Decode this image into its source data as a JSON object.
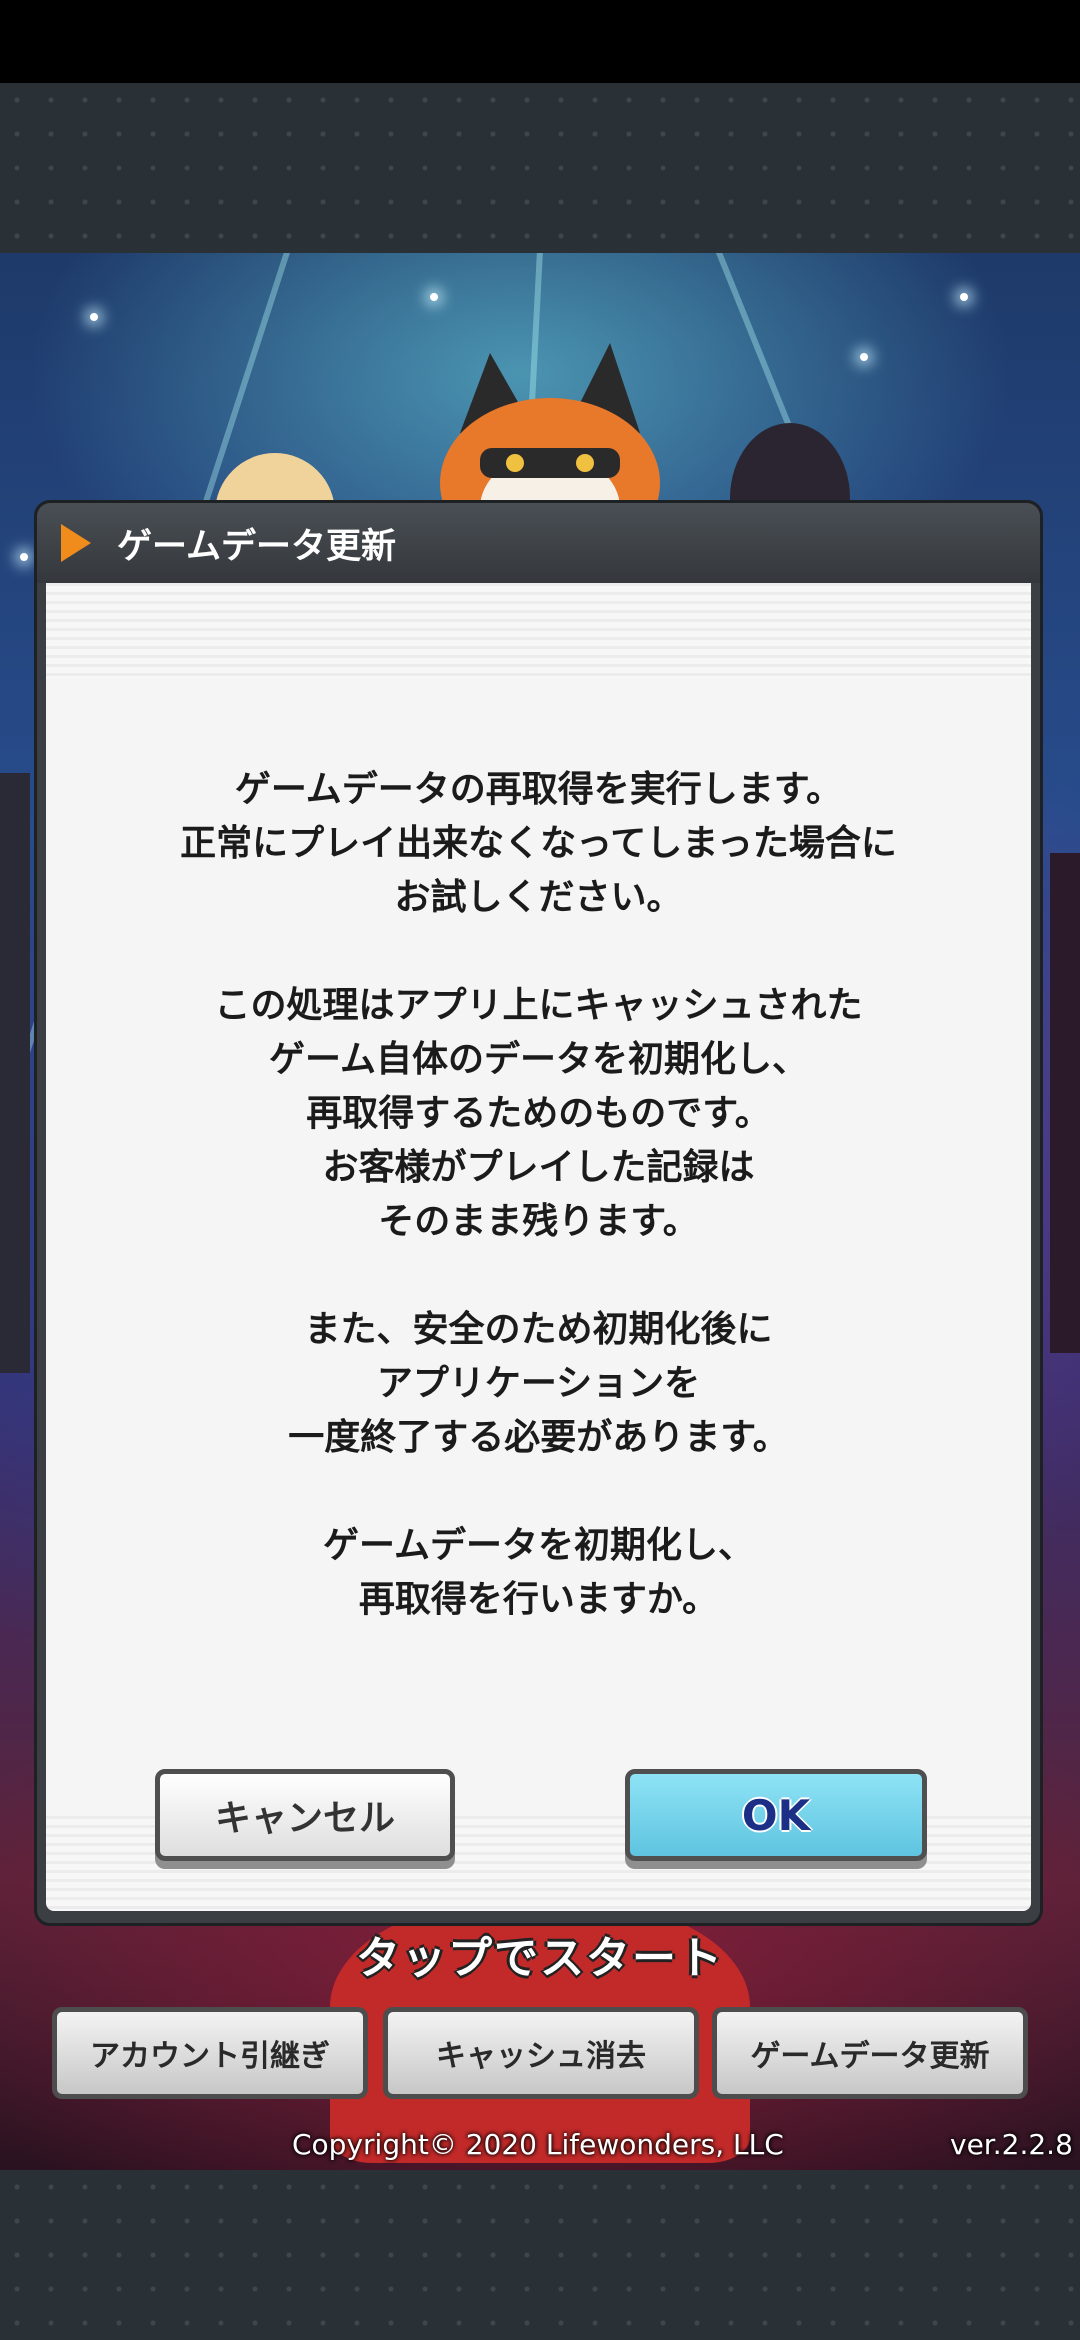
{
  "dialog": {
    "title": "ゲームデータ更新",
    "paragraphs": [
      [
        "ゲームデータの再取得を実行します。",
        "正常にプレイ出来なくなってしまった場合に",
        "お試しください。"
      ],
      [
        "この処理はアプリ上にキャッシュされた",
        "ゲーム自体のデータを初期化し、",
        "再取得するためのものです。",
        "お客様がプレイした記録は",
        "そのまま残ります。"
      ],
      [
        "また、安全のため初期化後に",
        "アプリケーションを",
        "一度終了する必要があります。"
      ],
      [
        "ゲームデータを初期化し、",
        "再取得を行いますか。"
      ]
    ],
    "cancel_label": "キャンセル",
    "ok_label": "OK"
  },
  "screen": {
    "tap_to_start": "タップでスタート",
    "buttons": {
      "account_transfer": "アカウント引継ぎ",
      "clear_cache": "キャッシュ消去",
      "update_game_data": "ゲームデータ更新"
    },
    "copyright": "Copyright© 2020 Lifewonders, LLC",
    "version": "ver.2.2.8"
  },
  "colors": {
    "header_icon": "#f08c1c",
    "ok_button": "#6fd0ea",
    "ok_text": "#1c2f86"
  },
  "icons": {
    "header": "play-triangle-icon"
  }
}
